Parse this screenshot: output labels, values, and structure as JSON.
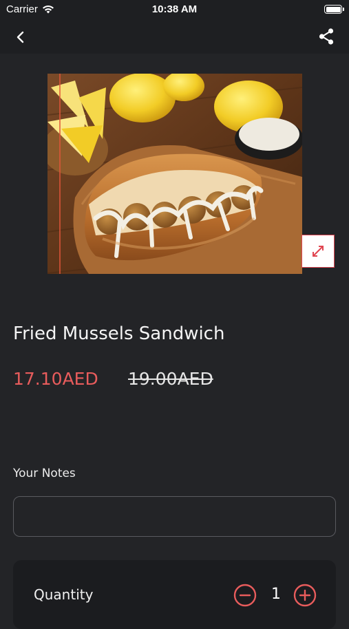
{
  "status_bar": {
    "carrier": "Carrier",
    "time": "10:38 AM",
    "wifi_icon": "wifi-icon",
    "battery_icon": "battery-icon"
  },
  "nav": {
    "back_icon": "chevron-left-icon",
    "share_icon": "share-icon"
  },
  "product": {
    "image": "fried-mussels-sandwich-photo",
    "expand_icon": "expand-arrows-icon",
    "title": "Fried Mussels Sandwich",
    "price": "17.10AED",
    "original_price": "19.00AED"
  },
  "notes": {
    "label": "Your Notes",
    "value": "",
    "placeholder": ""
  },
  "quantity": {
    "label": "Quantity",
    "value": "1",
    "minus_icon": "minus-circle-icon",
    "plus_icon": "plus-circle-icon"
  },
  "colors": {
    "background": "#232427",
    "accent": "#e85c5c",
    "card": "#1b1c1f"
  }
}
